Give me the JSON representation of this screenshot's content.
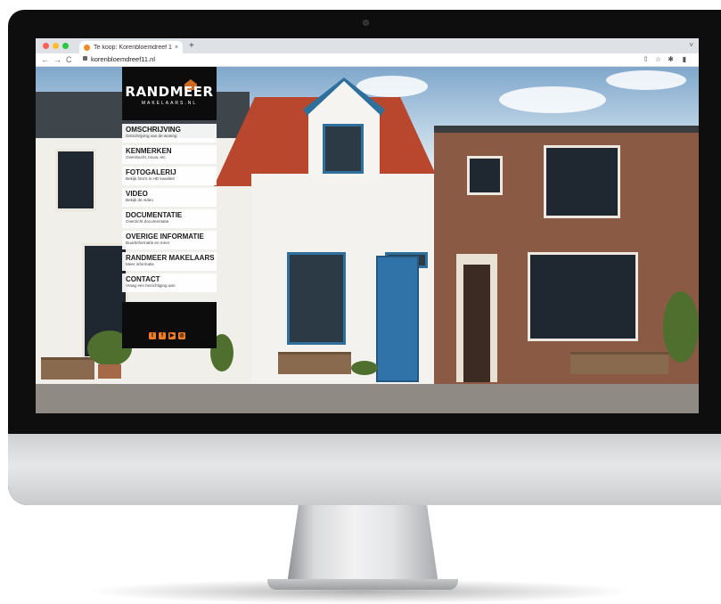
{
  "browser": {
    "tab_title": "Te koop: Korenbloemdreef 11, ·",
    "tab_close": "×",
    "new_tab": "+",
    "url": "korenbloemdreef11.nl",
    "nav": {
      "back": "←",
      "forward": "→",
      "reload": "C"
    },
    "tools": {
      "share": "⇧",
      "star": "☆",
      "extensions": "✱",
      "sidebar": "▮"
    },
    "chevron": "˅"
  },
  "brand": {
    "name": "RANDMEER",
    "sub": "MAKELAARS.NL",
    "accent_color": "#f07d24"
  },
  "menu": [
    {
      "title": "OMSCHRIJVING",
      "subtitle": "Omschrijving van de woning"
    },
    {
      "title": "KENMERKEN",
      "subtitle": "Overdracht, bouw, etc."
    },
    {
      "title": "FOTOGALERIJ",
      "subtitle": "Bekijk foto's in HD kwaliteit"
    },
    {
      "title": "VIDEO",
      "subtitle": "Bekijk de video"
    },
    {
      "title": "DOCUMENTATIE",
      "subtitle": "Overzicht documentatie"
    },
    {
      "title": "OVERIGE INFORMATIE",
      "subtitle": "Buurtinformatie en meer"
    },
    {
      "title": "RANDMEER MAKELAARS",
      "subtitle": "Meer informatie"
    },
    {
      "title": "CONTACT",
      "subtitle": "Vraag een bezichtiging aan"
    }
  ],
  "social": [
    {
      "icon": "twitter-icon",
      "glyph": "t"
    },
    {
      "icon": "facebook-icon",
      "glyph": "f"
    },
    {
      "icon": "youtube-icon",
      "glyph": "▶"
    },
    {
      "icon": "instagram-icon",
      "glyph": "◎"
    }
  ]
}
